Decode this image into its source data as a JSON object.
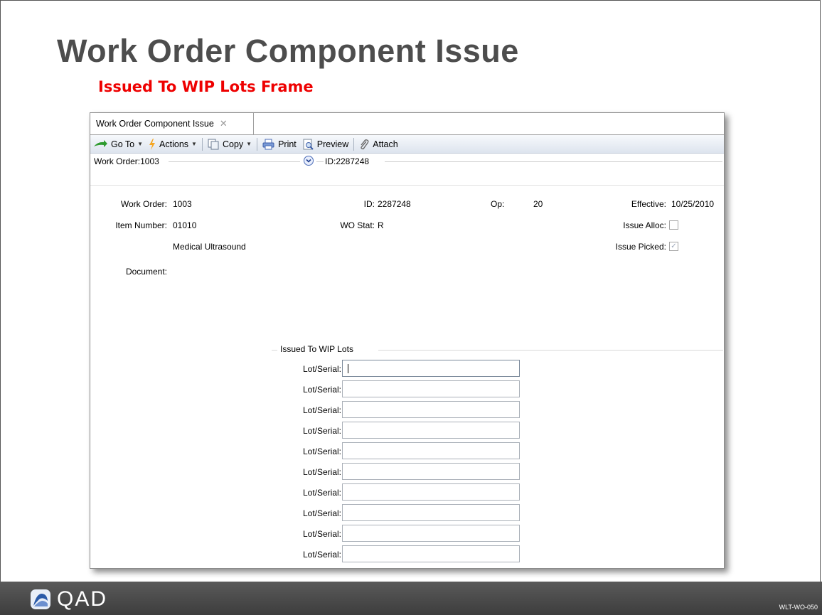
{
  "slide": {
    "title": "Work Order Component Issue",
    "subtitle": "Issued To WIP Lots Frame"
  },
  "window": {
    "tab_label": "Work Order Component Issue",
    "toolbar": {
      "goto": "Go To",
      "actions": "Actions",
      "copy": "Copy",
      "print": "Print",
      "preview": "Preview",
      "attach": "Attach"
    },
    "header": {
      "work_order": "Work Order:1003",
      "id": "ID:2287248"
    },
    "form": {
      "work_order_label": "Work Order:",
      "work_order_value": "1003",
      "id_label": "ID:",
      "id_value": "2287248",
      "op_label": "Op:",
      "op_value": "20",
      "effective_label": "Effective:",
      "effective_value": "10/25/2010",
      "item_number_label": "Item Number:",
      "item_number_value": "01010",
      "item_description": "Medical Ultrasound",
      "wo_stat_label": "WO Stat:",
      "wo_stat_value": "R",
      "issue_alloc_label": "Issue Alloc:",
      "issue_alloc_checked": false,
      "issue_picked_label": "Issue Picked:",
      "issue_picked_checked": true,
      "document_label": "Document:"
    },
    "wip_lots": {
      "title": "Issued To WIP Lots",
      "field_label": "Lot/Serial:",
      "rows": [
        "",
        "",
        "",
        "",
        "",
        "",
        "",
        "",
        "",
        ""
      ]
    }
  },
  "footer": {
    "logo_text": "QAD",
    "code": "WLT-WO-050"
  },
  "colors": {
    "title": "#4d4d4d",
    "subtitle": "#ee0000",
    "footer_bg": "#444444",
    "toolbar_bg": "#dde4ee"
  }
}
